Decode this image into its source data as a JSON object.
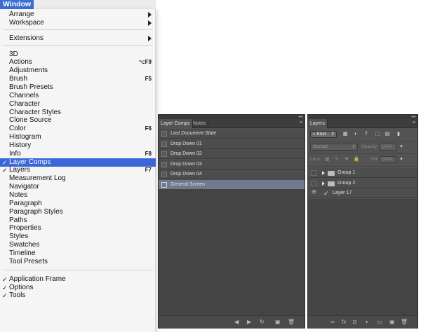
{
  "menubar": {
    "title": "Window"
  },
  "menu": {
    "items": [
      {
        "label": "Arrange",
        "submenu": true
      },
      {
        "label": "Workspace",
        "submenu": true
      },
      {
        "label": "Extensions",
        "submenu": true
      },
      {
        "label": "3D"
      },
      {
        "label": "Actions",
        "shortcut": "⌥F9"
      },
      {
        "label": "Adjustments"
      },
      {
        "label": "Brush",
        "shortcut": "F5"
      },
      {
        "label": "Brush Presets"
      },
      {
        "label": "Channels"
      },
      {
        "label": "Character"
      },
      {
        "label": "Character Styles"
      },
      {
        "label": "Clone Source"
      },
      {
        "label": "Color",
        "shortcut": "F6"
      },
      {
        "label": "Histogram"
      },
      {
        "label": "History"
      },
      {
        "label": "Info",
        "shortcut": "F8"
      },
      {
        "label": "Layer Comps",
        "checked": true,
        "selected": true
      },
      {
        "label": "Layers",
        "checked": true,
        "shortcut": "F7"
      },
      {
        "label": "Measurement Log"
      },
      {
        "label": "Navigator"
      },
      {
        "label": "Notes"
      },
      {
        "label": "Paragraph"
      },
      {
        "label": "Paragraph Styles"
      },
      {
        "label": "Paths"
      },
      {
        "label": "Properties"
      },
      {
        "label": "Styles"
      },
      {
        "label": "Swatches"
      },
      {
        "label": "Timeline"
      },
      {
        "label": "Tool Presets"
      },
      {
        "label": "Application Frame",
        "checked": true
      },
      {
        "label": "Options",
        "checked": true
      },
      {
        "label": "Tools",
        "checked": true
      }
    ],
    "check_glyph": "✓"
  },
  "layer_comps_panel": {
    "tabs": [
      "Layer Comps",
      "Notes"
    ],
    "close_glyph": "◂◂",
    "menu_glyph": "≡",
    "rows": [
      {
        "label": "Last Document State",
        "italic": true
      },
      {
        "label": "Drop Down 01"
      },
      {
        "label": "Drop Down 02"
      },
      {
        "label": "Drop Down 03"
      },
      {
        "label": "Drop Down 04"
      },
      {
        "label": "General Screen",
        "selected": true
      }
    ],
    "footer_icons": [
      {
        "name": "previous-comp-icon",
        "glyph": "◀"
      },
      {
        "name": "next-comp-icon",
        "glyph": "▶"
      },
      {
        "name": "update-comp-icon",
        "glyph": "↻"
      },
      {
        "name": "new-comp-icon",
        "glyph": "▣"
      },
      {
        "name": "delete-comp-icon",
        "glyph": "🗑"
      }
    ]
  },
  "layers_panel": {
    "tabs": [
      "Layers"
    ],
    "close_glyph": "◂◂",
    "menu_glyph": "≡",
    "filter": {
      "kind_label": "Kind",
      "kind_icon": "⌕"
    },
    "filter_icons": [
      {
        "name": "pixel-filter-icon",
        "glyph": "▦"
      },
      {
        "name": "adjustment-filter-icon",
        "glyph": "◑"
      },
      {
        "name": "type-filter-icon",
        "glyph": "T"
      },
      {
        "name": "shape-filter-icon",
        "glyph": "⬚"
      },
      {
        "name": "smart-object-filter-icon",
        "glyph": "▤"
      },
      {
        "name": "filter-toggle-icon",
        "glyph": "▮"
      }
    ],
    "blend_mode": "Normal",
    "opacity_label": "Opacity:",
    "opacity_value": "100%",
    "lock_label": "Lock:",
    "lock_icons": [
      {
        "name": "lock-transparent-icon",
        "glyph": "▦"
      },
      {
        "name": "lock-paint-icon",
        "glyph": "✎"
      },
      {
        "name": "lock-move-icon",
        "glyph": "✥"
      },
      {
        "name": "lock-all-icon",
        "glyph": "🔒"
      }
    ],
    "fill_label": "Fill:",
    "fill_value": "100%",
    "layers": [
      {
        "label": "Group 1",
        "type": "group",
        "visible": false
      },
      {
        "label": "Group 2",
        "type": "group",
        "visible": false
      },
      {
        "label": "Layer 17",
        "type": "layer",
        "visible": true
      }
    ],
    "eye_glyph": "👁",
    "brush_glyph": "✓",
    "footer_icons": [
      {
        "name": "link-layers-icon",
        "glyph": "∞"
      },
      {
        "name": "layer-style-icon",
        "glyph": "fx"
      },
      {
        "name": "layer-mask-icon",
        "glyph": "◘"
      },
      {
        "name": "adjustment-layer-icon",
        "glyph": "◐"
      },
      {
        "name": "new-group-icon",
        "glyph": "▭"
      },
      {
        "name": "new-layer-icon",
        "glyph": "▣"
      },
      {
        "name": "delete-layer-icon",
        "glyph": "🗑"
      }
    ]
  }
}
